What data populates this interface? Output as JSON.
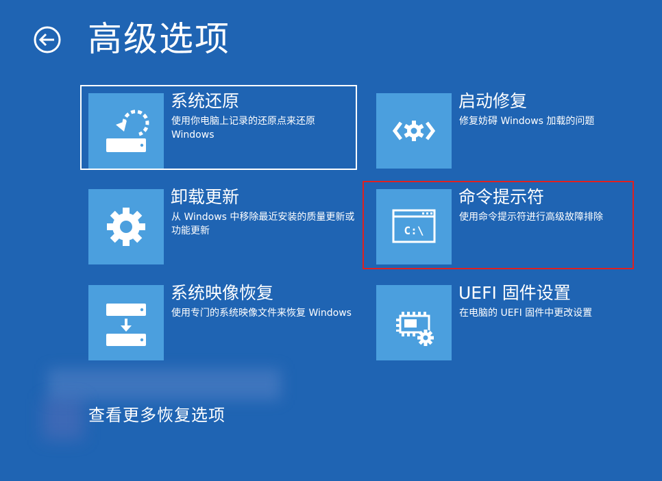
{
  "header": {
    "title": "高级选项",
    "back_icon": "back-arrow-icon"
  },
  "options": [
    {
      "id": "system-restore",
      "title": "系统还原",
      "description": "使用你电脑上记录的还原点来还原 Windows",
      "icon": "system-restore-icon",
      "focused": true
    },
    {
      "id": "startup-repair",
      "title": "启动修复",
      "description": "修复妨碍 Windows 加载的问题",
      "icon": "startup-repair-icon",
      "focused": false
    },
    {
      "id": "uninstall-updates",
      "title": "卸载更新",
      "description": "从 Windows 中移除最近安装的质量更新或功能更新",
      "icon": "gear-icon",
      "focused": false
    },
    {
      "id": "command-prompt",
      "title": "命令提示符",
      "description": "使用命令提示符进行高级故障排除",
      "icon": "command-prompt-icon",
      "icon_text": "C:\\",
      "focused": false,
      "highlighted": true
    },
    {
      "id": "system-image-recovery",
      "title": "系统映像恢复",
      "description": "使用专门的系统映像文件来恢复 Windows",
      "icon": "system-image-icon",
      "focused": false
    },
    {
      "id": "uefi-firmware-settings",
      "title": "UEFI 固件设置",
      "description": "在电脑的 UEFI 固件中更改设置",
      "icon": "firmware-chip-gear-icon",
      "focused": false
    }
  ],
  "footer": {
    "more_link": "查看更多恢复选项"
  },
  "colors": {
    "background": "#1f64b3",
    "tile": "#4b9fde",
    "text": "#ffffff",
    "highlight": "#e02020"
  }
}
